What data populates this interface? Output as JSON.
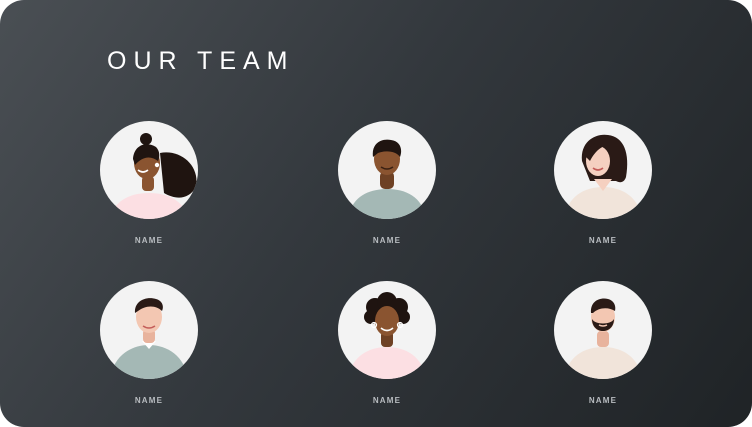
{
  "title": "OUR TEAM",
  "members": [
    {
      "name": "NAME",
      "icon": "woman-ponytail-avatar-icon",
      "skin": "#8a5430",
      "hair": "#1f1410",
      "shirt": "#fcdfe3"
    },
    {
      "name": "NAME",
      "icon": "man-short-hair-avatar-icon",
      "skin": "#8a5430",
      "hair": "#1f1410",
      "shirt": "#a4b8b5"
    },
    {
      "name": "NAME",
      "icon": "woman-long-hair-avatar-icon",
      "skin": "#f5d0c0",
      "hair": "#2a1a16",
      "shirt": "#f1e4da"
    },
    {
      "name": "NAME",
      "icon": "man-collared-shirt-avatar-icon",
      "skin": "#f3c7b2",
      "hair": "#2a1a16",
      "shirt": "#a4b8b5"
    },
    {
      "name": "NAME",
      "icon": "woman-curly-hair-avatar-icon",
      "skin": "#8a5430",
      "hair": "#1f1410",
      "shirt": "#fcdfe3"
    },
    {
      "name": "NAME",
      "icon": "man-beard-avatar-icon",
      "skin": "#f3c7b2",
      "hair": "#2a1a16",
      "shirt": "#f1e4da"
    }
  ]
}
